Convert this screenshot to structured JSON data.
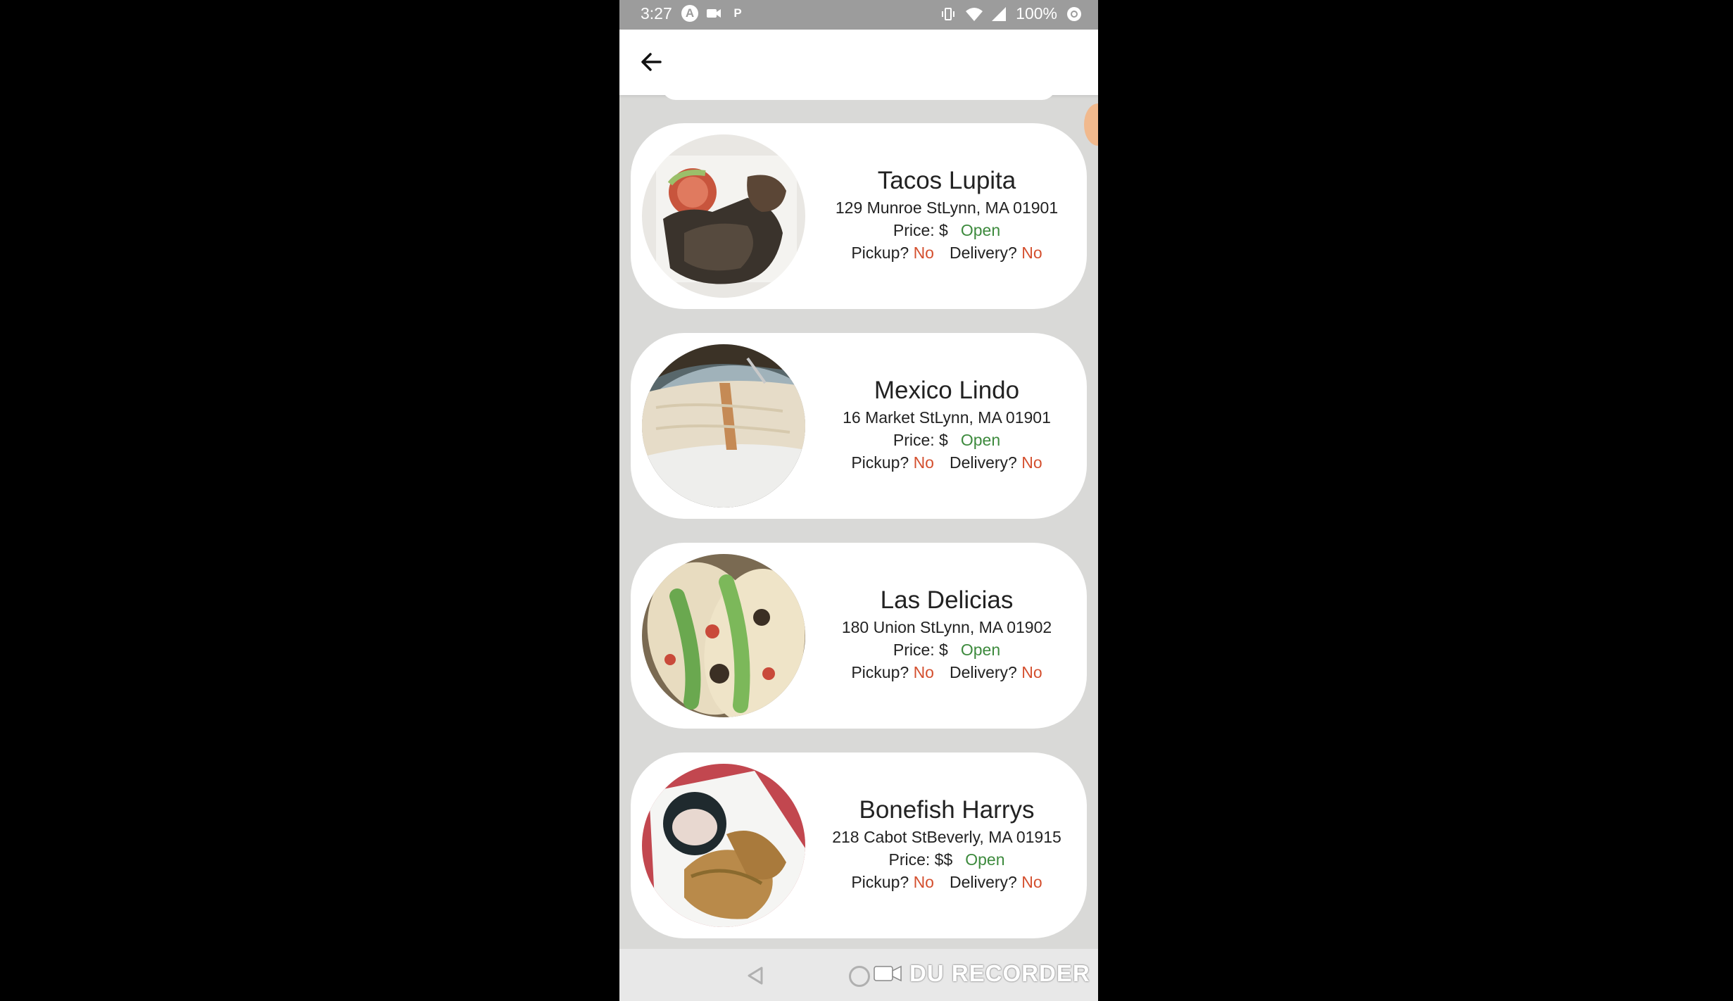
{
  "status_bar": {
    "time": "3:27",
    "battery": "100%",
    "icons_left": [
      "a-icon",
      "video-icon",
      "p-icon"
    ],
    "icons_right": [
      "vibrate-icon",
      "wifi-icon",
      "signal-icon",
      "battery-icon"
    ]
  },
  "app_bar": {
    "back_icon": "arrow-left-icon"
  },
  "restaurants": [
    {
      "name": "Tacos Lupita",
      "address": "129 Munroe StLynn, MA 01901",
      "price_label": "Price: $",
      "status": "Open",
      "pickup_label": "Pickup?",
      "pickup_value": "No",
      "delivery_label": "Delivery?",
      "delivery_value": "No",
      "image": "steak-plate-photo"
    },
    {
      "name": "Mexico Lindo",
      "address": "16 Market StLynn, MA 01901",
      "price_label": "Price: $",
      "status": "Open",
      "pickup_label": "Pickup?",
      "pickup_value": "No",
      "delivery_label": "Delivery?",
      "delivery_value": "No",
      "image": "burrito-photo"
    },
    {
      "name": "Las Delicias",
      "address": "180 Union StLynn, MA 01902",
      "price_label": "Price: $",
      "status": "Open",
      "pickup_label": "Pickup?",
      "pickup_value": "No",
      "delivery_label": "Delivery?",
      "delivery_value": "No",
      "image": "tacos-photo"
    },
    {
      "name": "Bonefish Harrys",
      "address": "218 Cabot StBeverly, MA 01915",
      "price_label": "Price: $$",
      "status": "Open",
      "pickup_label": "Pickup?",
      "pickup_value": "No",
      "delivery_label": "Delivery?",
      "delivery_value": "No",
      "image": "fried-fish-photo"
    }
  ],
  "colors": {
    "open": "#3d8a3d",
    "no": "#d4502f",
    "background": "#d9d9d7",
    "card": "#ffffff"
  },
  "nav_bar": {
    "watermark": "DU RECORDER"
  }
}
